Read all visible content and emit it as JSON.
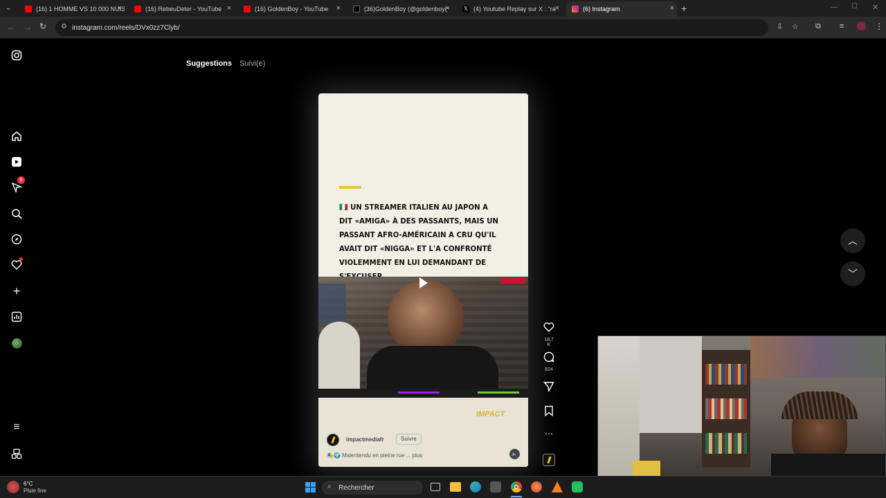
{
  "browser": {
    "tabs": [
      {
        "title": "(16) 1 HOMME VS 10 000 NUIS",
        "color": "#ff0000"
      },
      {
        "title": "(16) RebeuDeter - YouTube",
        "color": "#ff0000"
      },
      {
        "title": "(16) GoldenBoy - YouTube",
        "color": "#ff0000"
      },
      {
        "title": "(36)GoldenBoy (@goldenboy(",
        "color": "#111111"
      },
      {
        "title": "(4) Youtube Replay sur X : \"ra",
        "color": "#111111"
      },
      {
        "title": "(6) Instagram",
        "color": "#e1306c"
      }
    ],
    "url": "instagram.com/reels/DVx0zz7Clyb/"
  },
  "instagram": {
    "feed_tabs": [
      "Suggestions",
      "Suivi(e)"
    ],
    "nav_badge": "6",
    "reel": {
      "headline": "🇮🇹 UN STREAMER ITALIEN AU JAPON A DIT «AMIGA» À DES PASSANTS, MAIS UN PASSANT AFRO-AMÉRICAIN A CRU QU'IL AVAIT DIT «NIGGA» ET L'A CONFRONTÉ VIOLEMMENT EN LUI DEMANDANT DE S'EXCUSER.",
      "username": "impactmediafr",
      "follow_label": "Suivre",
      "caption": "🎭🌍 Malentendu en pleine rue ... plus",
      "brand": "IMPACT"
    },
    "actions": {
      "likes": "18,7 K",
      "comments": "824"
    }
  },
  "taskbar": {
    "weather_temp": "6°C",
    "weather_desc": "Pluie fine",
    "search_label": "Rechercher"
  },
  "colors": {
    "accent_yellow": "#e6c530",
    "notification_red": "#ff3040"
  }
}
